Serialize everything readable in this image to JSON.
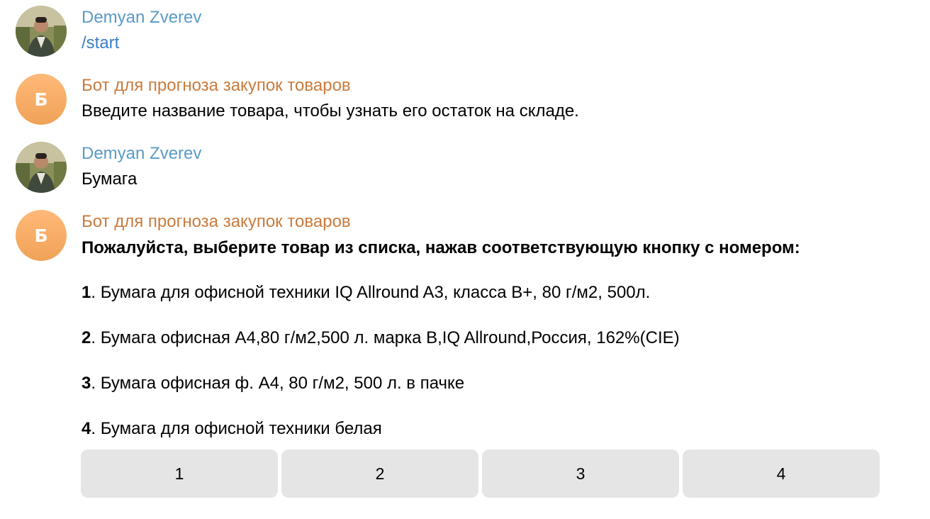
{
  "messages": [
    {
      "sender": "Demyan Zverev",
      "text": "/start"
    },
    {
      "sender": "Бот для прогноза закупок товаров",
      "avatar_letter": "Б",
      "text": "Введите название товара, чтобы узнать его остаток на складе."
    },
    {
      "sender": "Demyan Zverev",
      "text": "Бумага"
    },
    {
      "sender": "Бот для прогноза закупок товаров",
      "avatar_letter": "Б",
      "heading": "Пожалуйста, выберите товар из списка, нажав соответствующую кнопку с номером:",
      "items": [
        {
          "num": "1",
          "text": ". Бумага для офисной техники IQ Allround A3, класса B+, 80 г/м2, 500л."
        },
        {
          "num": "2",
          "text": ". Бумага офисная A4,80 г/м2,500 л. марка B,IQ Allround,Россия, 162%(CIE)"
        },
        {
          "num": "3",
          "text": ". Бумага  офисная ф. А4, 80 г/м2, 500 л. в пачке"
        },
        {
          "num": "4",
          "text": ". Бумага для офисной техники белая"
        }
      ]
    }
  ],
  "keyboard": {
    "buttons": [
      "1",
      "2",
      "3",
      "4"
    ]
  },
  "colors": {
    "user_name": "#5a9bc8",
    "bot_name": "#c97b3c",
    "command": "#3a7fc8",
    "bot_avatar": "#f5a962",
    "button_bg": "#e5e5e5"
  }
}
